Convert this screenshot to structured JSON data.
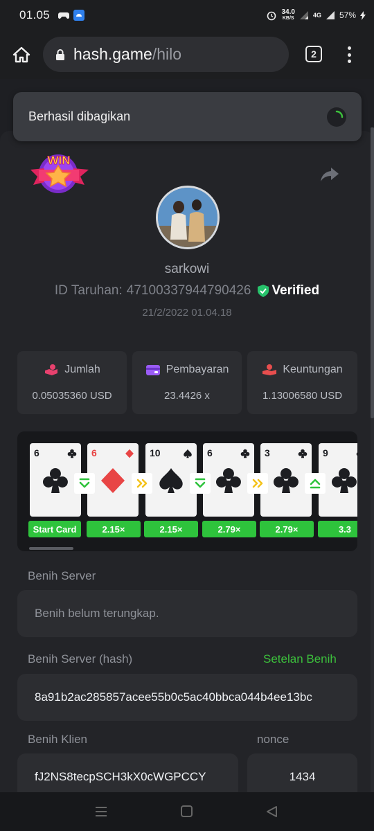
{
  "status_bar": {
    "time": "01.05",
    "speed_value": "34.0",
    "speed_unit": "KB/S",
    "network": "4G",
    "battery": "57%"
  },
  "browser": {
    "url_host": "hash.game",
    "url_path": "/hilo",
    "tab_count": "2"
  },
  "toast": {
    "message": "Berhasil dibagikan"
  },
  "bet": {
    "username": "sarkowi",
    "bet_id_label": "ID Taruhan:",
    "bet_id": "47100337944790426",
    "verified_label": "Verified",
    "date": "21/2/2022 01.04.18",
    "win_label": "WIN"
  },
  "stats": [
    {
      "label": "Jumlah",
      "value": "0.05035360 USD",
      "icon": "money-hand-icon"
    },
    {
      "label": "Pembayaran",
      "value": "23.4426 x",
      "icon": "wallet-icon"
    },
    {
      "label": "Keuntungan",
      "value": "1.13006580 USD",
      "icon": "profit-hand-icon"
    }
  ],
  "cards": [
    {
      "rank": "6",
      "suit": "clubs",
      "multiplier": "Start Card"
    },
    {
      "rank": "6",
      "suit": "diamonds",
      "multiplier": "2.15×"
    },
    {
      "rank": "10",
      "suit": "spades",
      "multiplier": "2.15×"
    },
    {
      "rank": "6",
      "suit": "clubs",
      "multiplier": "2.79×"
    },
    {
      "rank": "3",
      "suit": "clubs",
      "multiplier": "2.79×"
    },
    {
      "rank": "9",
      "suit": "clubs",
      "multiplier": "3.3"
    }
  ],
  "guesses": [
    "lower-or-equal",
    "skip",
    "lower-or-equal",
    "skip",
    "higher-or-equal"
  ],
  "seeds": {
    "server_seed_label": "Benih Server",
    "server_seed_value": "Benih belum terungkap.",
    "server_hash_label": "Benih Server (hash)",
    "seed_settings_link": "Setelan Benih",
    "server_hash_value": "8a91b2ac285857acee55b0c5ac40bbca044b4ee13bc",
    "client_seed_label": "Benih Klien",
    "client_seed_value": "fJ2NS8tecpSCH3kX0cWGPCCY",
    "nonce_label": "nonce",
    "nonce_value": "1434"
  },
  "colors": {
    "accent_green": "#2ec33c",
    "link_green": "#3cc03c",
    "verified_green": "#27c26b",
    "jumlah_icon": "#e8416e",
    "pembayaran_icon": "#9b5cf6",
    "keuntungan_icon": "#e84e4e"
  }
}
